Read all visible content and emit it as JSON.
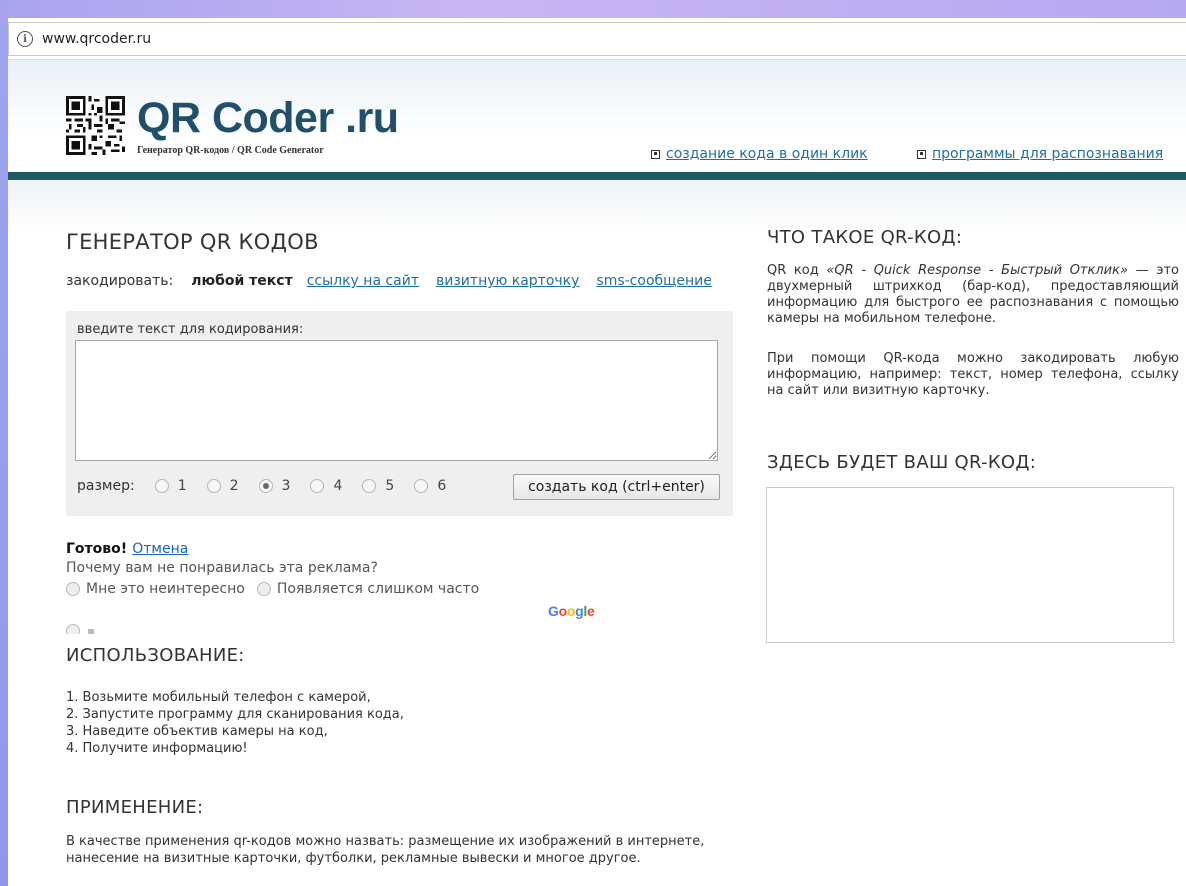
{
  "browser": {
    "url": "www.qrcoder.ru"
  },
  "header": {
    "logo_title": "QR Coder .ru",
    "logo_subtitle": "Генератор QR-кодов / QR Code Generator",
    "nav": [
      {
        "label": "создание кода в один клик"
      },
      {
        "label": "программы для распознавания"
      }
    ]
  },
  "generator": {
    "title": "ГЕНЕРАТОР QR КОДОВ",
    "encode_label": "закодировать:",
    "encode_options": [
      "любой текст",
      "ссылку на сайт",
      "визитную карточку",
      "sms-сообщение"
    ],
    "encode_selected": "любой текст",
    "input_label": "введите текст для кодирования:",
    "input_value": "",
    "size_label": "размер:",
    "sizes": [
      "1",
      "2",
      "3",
      "4",
      "5",
      "6"
    ],
    "size_selected": "3",
    "create_button": "создать код (ctrl+enter)"
  },
  "ad_feedback": {
    "done": "Готово!",
    "cancel": "Отмена",
    "question": "Почему вам не понравилась эта реклама?",
    "options": [
      "Мне это неинтересно",
      "Появляется слишком часто"
    ],
    "brand": "Google"
  },
  "usage": {
    "title": "ИСПОЛЬЗОВАНИЕ:",
    "steps": [
      "1. Возьмите мобильный телефон с камерой,",
      "2. Запустите программу для сканирования кода,",
      "3. Наведите объектив камеры на код,",
      "4. Получите информацию!"
    ]
  },
  "application": {
    "title": "ПРИМЕНЕНИЕ:",
    "text": "В качестве применения qr-кодов можно назвать: размещение их изображений в интернете, нанесение на визитные карточки, футболки, рекламные вывески и многое другое."
  },
  "about": {
    "title": "ЧТО ТАКОЕ QR-КОД:",
    "p1_before": "QR код ",
    "p1_italic": "«QR - Quick Response - Быстрый Отклик»",
    "p1_after": " — это двухмерный штрихкод (бар-код), предоставляющий информацию для быстрого ее распознавания с помощью камеры на мобильном телефоне.",
    "p2": "При помощи QR-кода можно закодировать любую информацию, например: текст, номер телефона, ссылку на сайт или визитную карточку."
  },
  "result": {
    "title": "ЗДЕСЬ БУДЕТ ВАШ QR-КОД:"
  },
  "colors": {
    "link": "#1f6fa3",
    "header_bar": "#1f5a66",
    "logo": "#1f4f6b",
    "frame": "#9fa6ee"
  }
}
